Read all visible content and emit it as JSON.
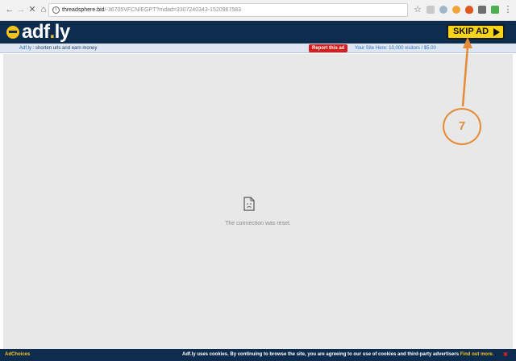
{
  "browser": {
    "url_host": "threadsphere.bid",
    "url_path": "/-36705VFCN/EGPT?mdad=3307240343-1520967583"
  },
  "header": {
    "logo_prefix": "adf",
    "logo_dot": ".",
    "logo_suffix": "ly",
    "skip_label": "SKIP AD"
  },
  "subbar": {
    "tagline_brand": "Adf.ly",
    "tagline_text": " : shorten urls and earn money",
    "report_label": "Report this ad",
    "your_site_label": "Your Site Here: 10,000 visitors / $5.00"
  },
  "error": {
    "message": "The connection was reset."
  },
  "annotation": {
    "number": "7",
    "color": "#e58b35"
  },
  "footer": {
    "adchoices_label": "AdChoices",
    "cookie_text": "Adf.ly uses cookies. By continuing to browse the site, you are agreeing to our use of cookies and third-party advertisers ",
    "find_out_more": "Find out more.",
    "close_symbol": "✖"
  },
  "colors": {
    "header_bg": "#0e2d4e",
    "skip_bg": "#f7d417",
    "report_bg": "#d61e1e"
  }
}
